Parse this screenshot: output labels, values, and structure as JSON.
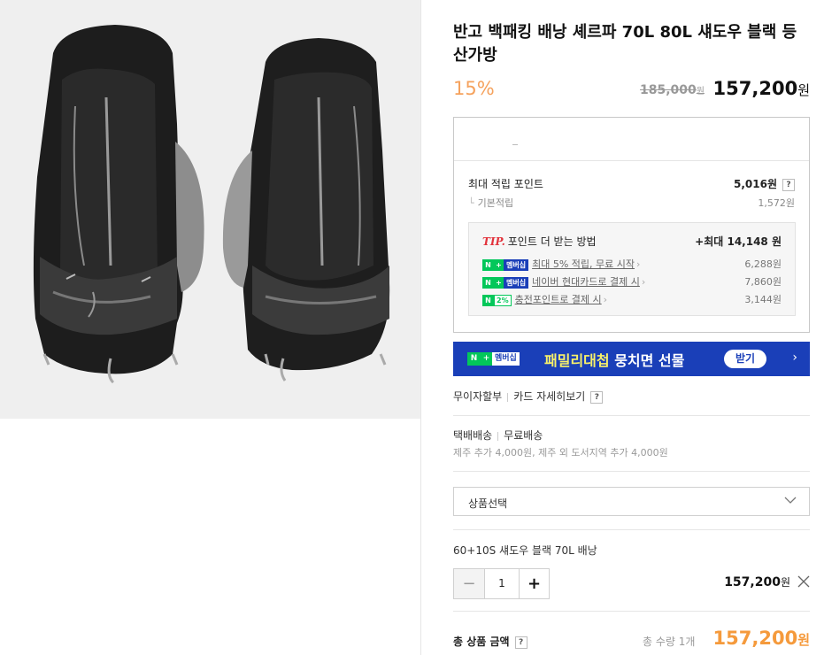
{
  "product": {
    "title": "반고 백패킹 배낭 셰르파 70L 80L 섀도우 블랙 등산가방",
    "discount": "15%",
    "original_price": "185,000",
    "original_price_unit": "원",
    "sale_price": "157,200",
    "sale_price_unit": "원",
    "image_alt": "Vango Sherpa backpack front and side view"
  },
  "points": {
    "max_label": "최대 적립 포인트",
    "max_value": "5,016원",
    "help": "?",
    "base_label": "기본적립",
    "base_value": "1,572원",
    "tip_badge": "TIP.",
    "tip_title": "포인트 더 받는 방법",
    "tip_max": "+최대 14,148 원",
    "items": [
      {
        "badge": "멤버십",
        "label": "최대 5% 적립, 무료 시작",
        "value": "6,288원"
      },
      {
        "badge": "멤버십",
        "label": "네이버 현대카드로 결제 시",
        "value": "7,860원"
      },
      {
        "badge": "2%",
        "label": "충전포인트로 결제 시",
        "value": "3,144원"
      }
    ]
  },
  "banner": {
    "badge_n": "N",
    "badge_plus": "+",
    "badge_mem": "멤버십",
    "text_highlight": "패밀리대첩",
    "text_rest": "뭉치면 선물",
    "button": "받기",
    "colors": {
      "bg": "#1a3fb8",
      "accent": "#f7f06a"
    }
  },
  "installment": {
    "label": "무이자할부",
    "card_detail": "카드 자세히보기",
    "help": "?"
  },
  "shipping": {
    "method": "택배배송",
    "fee": "무료배송",
    "extra": "제주 추가 4,000원, 제주 외 도서지역 추가 4,000원"
  },
  "option_select": {
    "placeholder": "상품선택"
  },
  "selected_option": {
    "name": "60+10S 섀도우 블랙 70L 배낭",
    "minus": "−",
    "quantity": "1",
    "plus": "+",
    "price": "157,200",
    "price_unit": "원"
  },
  "total": {
    "label": "총 상품 금액",
    "help": "?",
    "qty_text": "총 수량 1개",
    "price": "157,200",
    "price_unit": "원"
  },
  "colors": {
    "discount": "#f5a25d",
    "total": "#f59a3c",
    "npay_green": "#03c75a",
    "tip_red": "#e2323b"
  }
}
